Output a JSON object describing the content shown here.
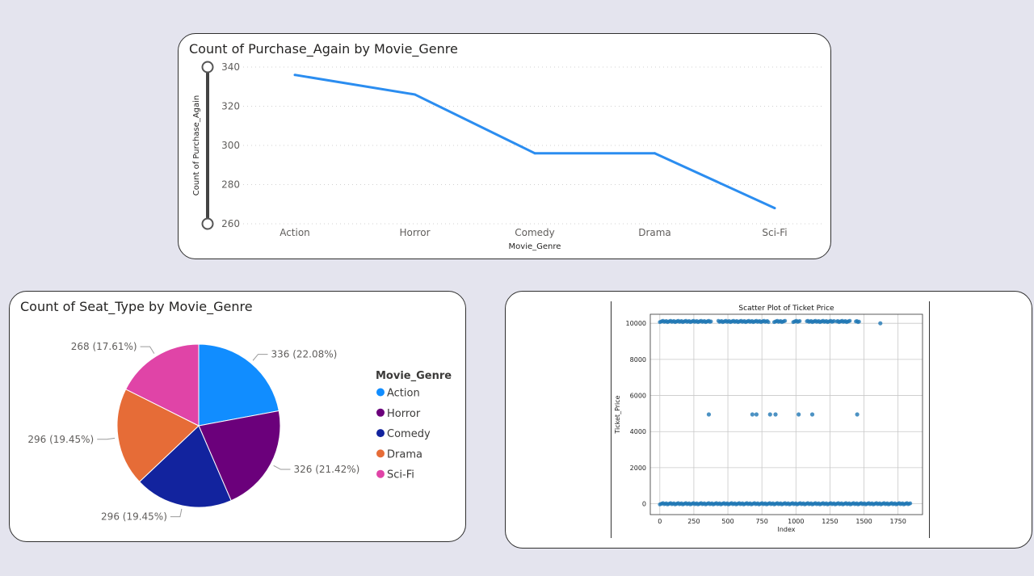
{
  "line_chart": {
    "title": "Count of Purchase_Again by Movie_Genre",
    "chart_data": {
      "type": "line",
      "categories": [
        "Action",
        "Horror",
        "Comedy",
        "Drama",
        "Sci-Fi"
      ],
      "values": [
        336,
        326,
        296,
        296,
        268
      ],
      "xlabel": "Movie_Genre",
      "ylabel": "Count of Purchase_Again",
      "ylim": [
        260,
        340
      ],
      "yticks": [
        340,
        320,
        300,
        280,
        260
      ],
      "grid": "horizontal dotted",
      "line_color": "#2b8df0"
    }
  },
  "pie_chart": {
    "title": "Count of Seat_Type by Movie_Genre",
    "legend_title": "Movie_Genre",
    "legend_position": "right",
    "chart_data": {
      "type": "pie",
      "slices": [
        {
          "label": "Action",
          "value": 336,
          "data_label": "336 (22.08%)",
          "color": "#118dff"
        },
        {
          "label": "Horror",
          "value": 326,
          "data_label": "326 (21.42%)",
          "color": "#6b007b"
        },
        {
          "label": "Comedy",
          "value": 296,
          "data_label": "296 (19.45%)",
          "color": "#12239e"
        },
        {
          "label": "Drama",
          "value": 296,
          "data_label": "296 (19.45%)",
          "color": "#e66c37"
        },
        {
          "label": "Sci-Fi",
          "value": 268,
          "data_label": "268 (17.61%)",
          "color": "#e044a7"
        }
      ]
    }
  },
  "scatter_chart": {
    "chart_data": {
      "type": "scatter",
      "title": "Scatter Plot of Ticket Price",
      "xlabel": "Index",
      "ylabel": "Ticket_Price",
      "xlim": [
        -70,
        1930
      ],
      "ylim": [
        -600,
        10500
      ],
      "xticks": [
        0,
        250,
        500,
        750,
        1000,
        1250,
        1500,
        1750
      ],
      "yticks": [
        0,
        2000,
        4000,
        6000,
        8000,
        10000
      ],
      "grid": true,
      "point_color": "#1f77b4",
      "clusters": [
        {
          "y": 10100,
          "x_ranges": [
            [
              0,
              380
            ],
            [
              430,
              800
            ],
            [
              840,
              920
            ],
            [
              980,
              1030
            ],
            [
              1080,
              1280
            ],
            [
              1300,
              1400
            ],
            [
              1440,
              1470
            ]
          ]
        },
        {
          "y": 0,
          "x_ranges": [
            [
              0,
              1840
            ]
          ]
        }
      ],
      "points": [
        {
          "x": 1620,
          "y": 10000
        },
        {
          "x": 360,
          "y": 4950
        },
        {
          "x": 680,
          "y": 4950
        },
        {
          "x": 710,
          "y": 4950
        },
        {
          "x": 810,
          "y": 4950
        },
        {
          "x": 850,
          "y": 4950
        },
        {
          "x": 1020,
          "y": 4950
        },
        {
          "x": 1120,
          "y": 4950
        },
        {
          "x": 1450,
          "y": 4950
        }
      ]
    }
  }
}
